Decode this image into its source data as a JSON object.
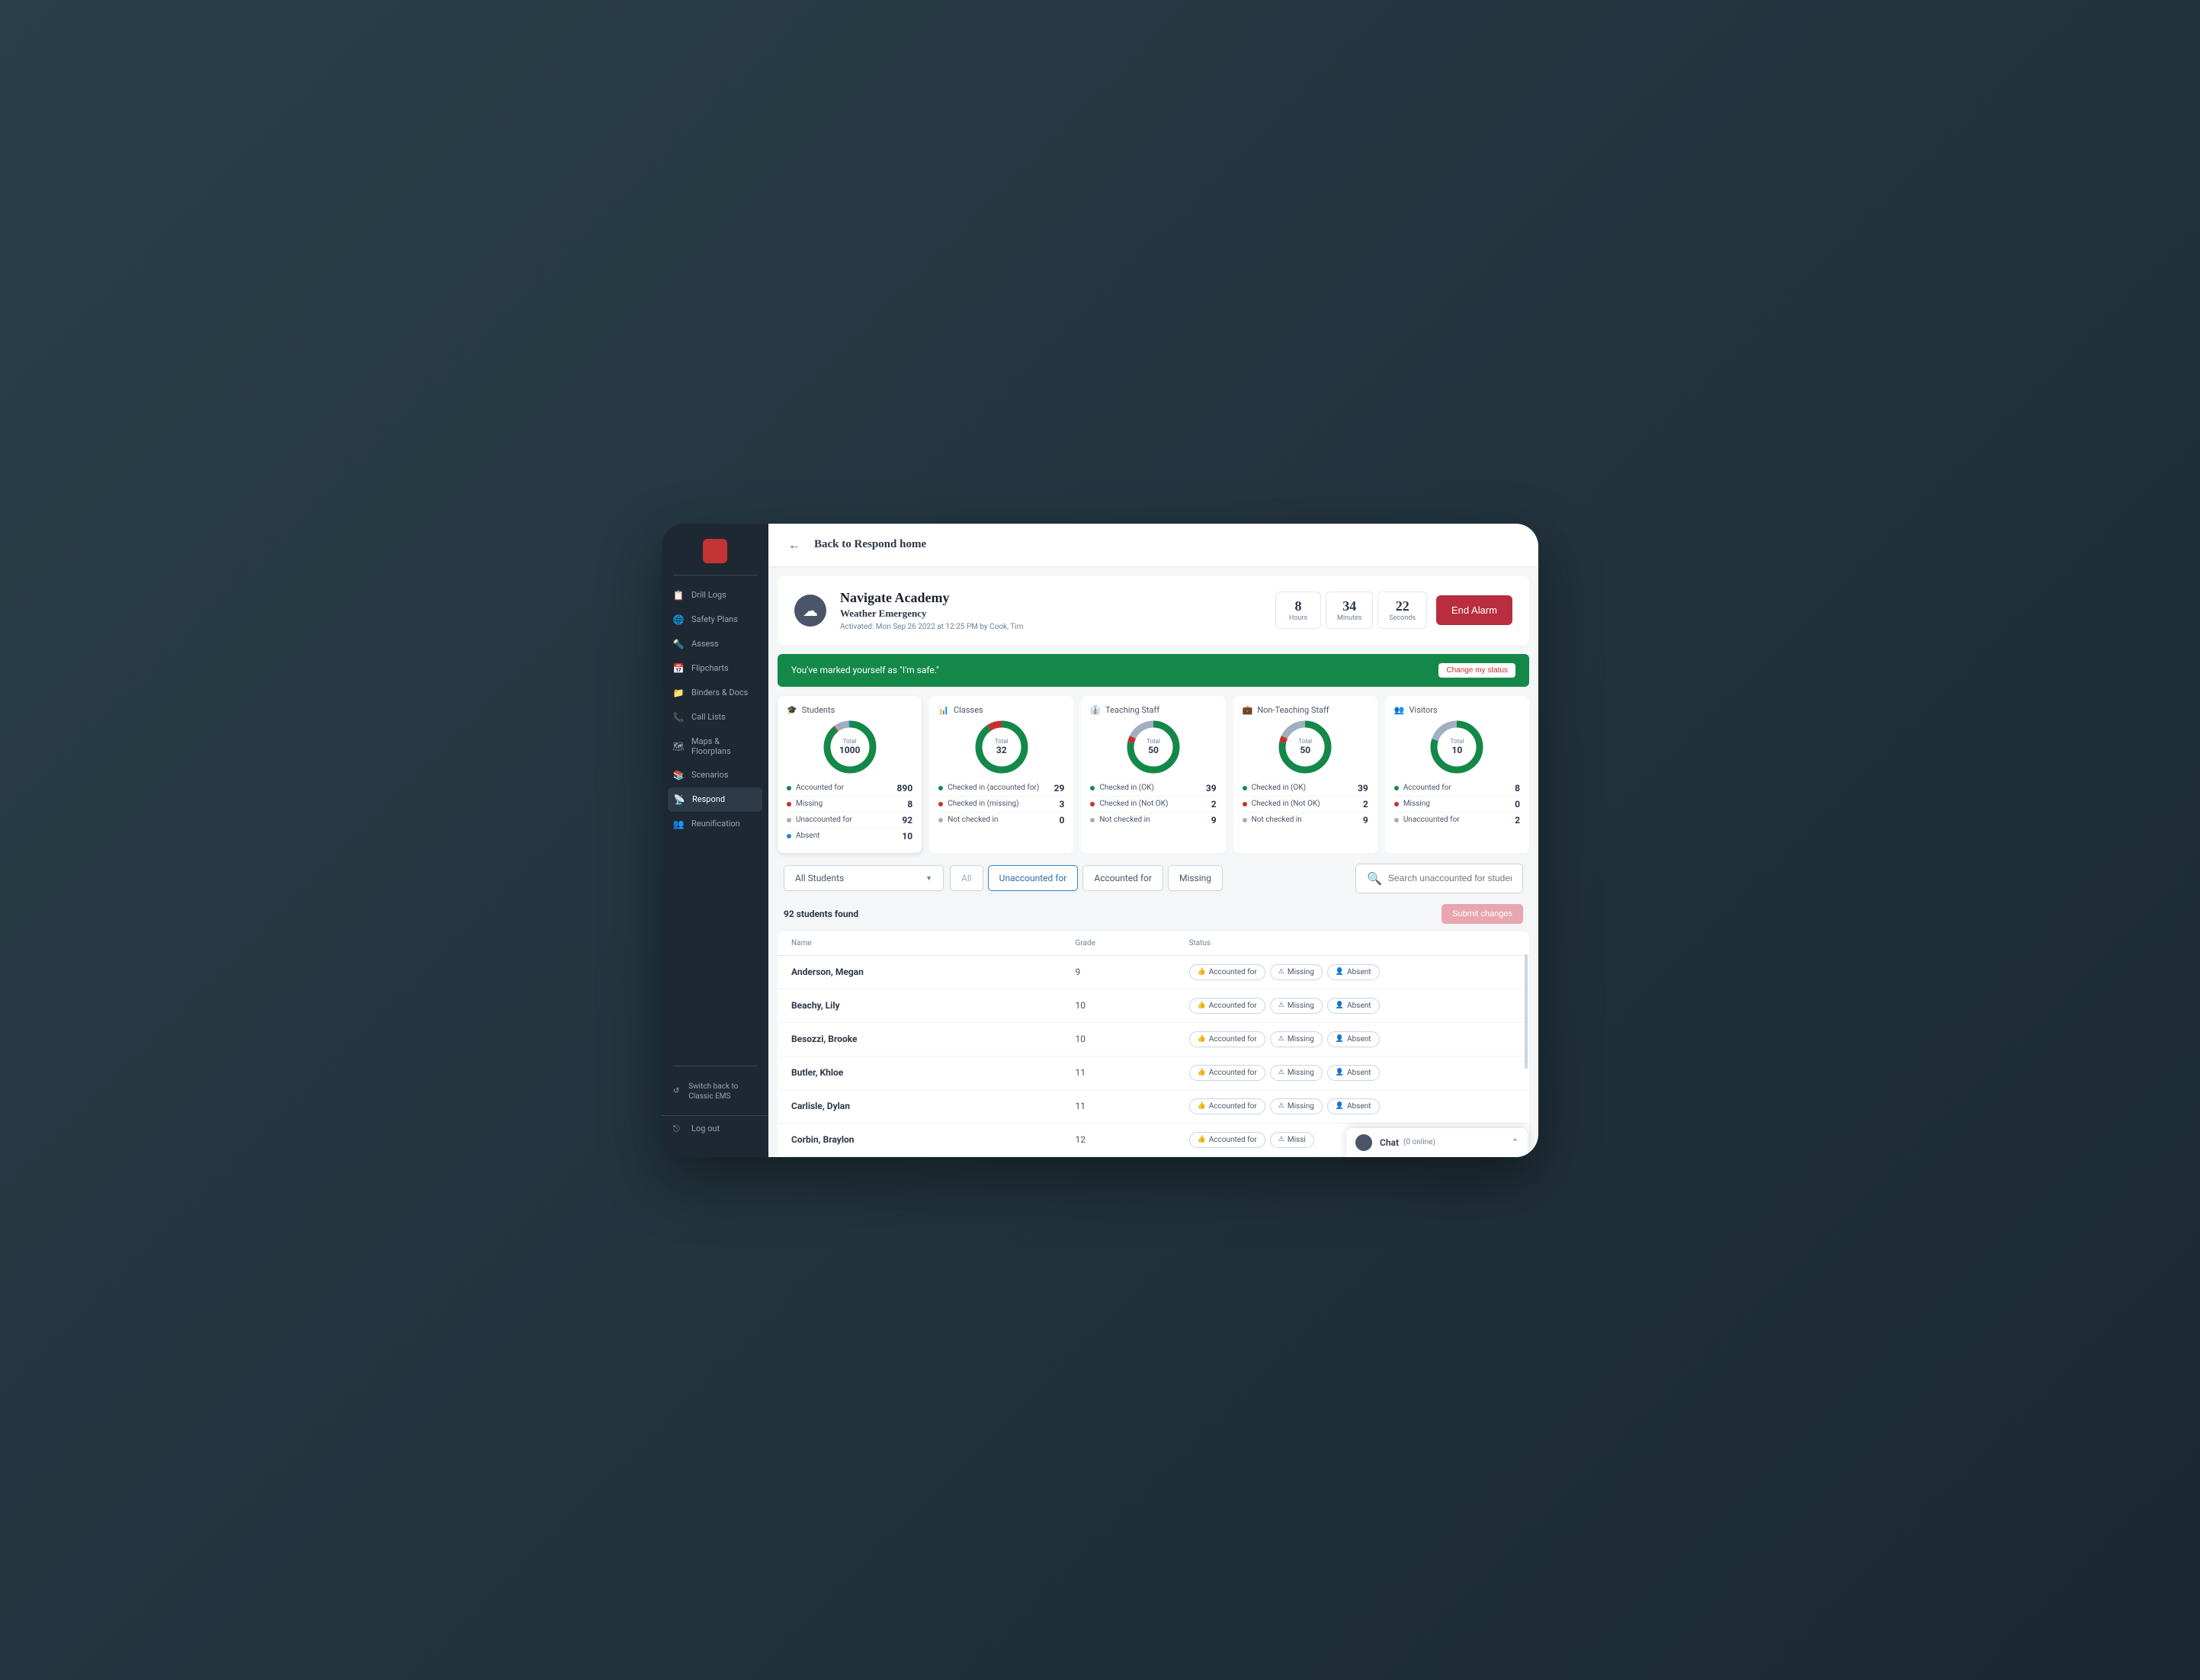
{
  "sidebar": {
    "items": [
      {
        "label": "Drill Logs",
        "icon": "📋"
      },
      {
        "label": "Safety Plans",
        "icon": "🌐"
      },
      {
        "label": "Assess",
        "icon": "🔦"
      },
      {
        "label": "Flipcharts",
        "icon": "📅"
      },
      {
        "label": "Binders & Docs",
        "icon": "📁"
      },
      {
        "label": "Call Lists",
        "icon": "📞"
      },
      {
        "label": "Maps & Floorplans",
        "icon": "🗺"
      },
      {
        "label": "Scenarios",
        "icon": "📚"
      },
      {
        "label": "Respond",
        "icon": "📡"
      },
      {
        "label": "Reunification",
        "icon": "👥"
      }
    ],
    "switch_back": "Switch back to Classic EMS",
    "logout": "Log out"
  },
  "topbar": {
    "back": "Back to Respond home"
  },
  "header": {
    "school": "Navigate Academy",
    "type": "Weather Emergency",
    "activated": "Activated: Mon Sep 26 2022 at 12:25 PM by Cook, Tim",
    "timer": [
      {
        "val": "8",
        "lbl": "Hours"
      },
      {
        "val": "34",
        "lbl": "Minutes"
      },
      {
        "val": "22",
        "lbl": "Seconds"
      }
    ],
    "end_alarm": "End Alarm"
  },
  "banner": {
    "msg": "You've marked yourself as \"I'm safe.\"",
    "btn": "Change my status"
  },
  "stats": [
    {
      "title": "Students",
      "icon": "🎓",
      "total_lbl": "Total",
      "total": "1000",
      "lines": [
        {
          "dot": "green",
          "label": "Accounted for",
          "val": "890"
        },
        {
          "dot": "red",
          "label": "Missing",
          "val": "8"
        },
        {
          "dot": "gray",
          "label": "Unaccounted for",
          "val": "92"
        },
        {
          "dot": "blue",
          "label": "Absent",
          "val": "10"
        }
      ],
      "donut": {
        "green": 89,
        "red": 0.8,
        "gray": 9.2,
        "blue": 1
      }
    },
    {
      "title": "Classes",
      "icon": "📊",
      "total_lbl": "Total",
      "total": "32",
      "lines": [
        {
          "dot": "green",
          "label": "Checked in (accounted for)",
          "val": "29"
        },
        {
          "dot": "red",
          "label": "Checked in (missing)",
          "val": "3"
        },
        {
          "dot": "gray",
          "label": "Not checked in",
          "val": "0"
        }
      ],
      "donut": {
        "green": 90.6,
        "red": 9.4,
        "gray": 0,
        "blue": 0
      }
    },
    {
      "title": "Teaching Staff",
      "icon": "👔",
      "total_lbl": "Total",
      "total": "50",
      "lines": [
        {
          "dot": "green",
          "label": "Checked in (OK)",
          "val": "39"
        },
        {
          "dot": "red",
          "label": "Checked in (Not OK)",
          "val": "2"
        },
        {
          "dot": "gray",
          "label": "Not checked in",
          "val": "9"
        }
      ],
      "donut": {
        "green": 78,
        "red": 4,
        "gray": 18,
        "blue": 0
      }
    },
    {
      "title": "Non-Teaching Staff",
      "icon": "💼",
      "total_lbl": "Total",
      "total": "50",
      "lines": [
        {
          "dot": "green",
          "label": "Checked in (OK)",
          "val": "39"
        },
        {
          "dot": "red",
          "label": "Checked in (Not OK)",
          "val": "2"
        },
        {
          "dot": "gray",
          "label": "Not checked in",
          "val": "9"
        }
      ],
      "donut": {
        "green": 78,
        "red": 4,
        "gray": 18,
        "blue": 0
      }
    },
    {
      "title": "Visitors",
      "icon": "👥",
      "total_lbl": "Total",
      "total": "10",
      "lines": [
        {
          "dot": "green",
          "label": "Accounted for",
          "val": "8"
        },
        {
          "dot": "red",
          "label": "Missing",
          "val": "0"
        },
        {
          "dot": "gray",
          "label": "Unaccounted for",
          "val": "2"
        }
      ],
      "donut": {
        "green": 80,
        "red": 0,
        "gray": 20,
        "blue": 0
      }
    }
  ],
  "filters": {
    "select": "All Students",
    "tabs": [
      "All",
      "Unaccounted for",
      "Accounted for",
      "Missing"
    ],
    "active_tab": 1,
    "search_placeholder": "Search unaccounted for students"
  },
  "results": {
    "count": "92 students found",
    "submit": "Submit changes",
    "headers": {
      "name": "Name",
      "grade": "Grade",
      "status": "Status"
    },
    "status_btns": {
      "accounted": "Accounted for",
      "missing": "Missing",
      "absent": "Absent"
    },
    "rows": [
      {
        "name": "Anderson, Megan",
        "grade": "9"
      },
      {
        "name": "Beachy, Lily",
        "grade": "10"
      },
      {
        "name": "Besozzi, Brooke",
        "grade": "10"
      },
      {
        "name": "Butler, Khloe",
        "grade": "11"
      },
      {
        "name": "Carlisle, Dylan",
        "grade": "11"
      },
      {
        "name": "Corbin, Braylon",
        "grade": "12"
      }
    ]
  },
  "chat": {
    "title": "Chat",
    "count": "(0 online)"
  }
}
